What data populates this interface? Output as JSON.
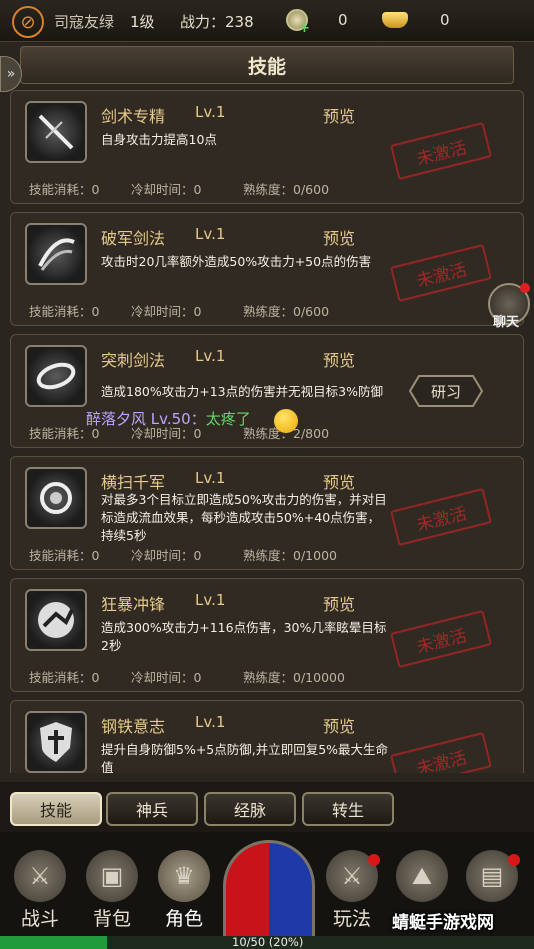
{
  "topbar": {
    "player_name": "司寇友绿",
    "player_level": "1级",
    "power": "战力：238",
    "coins": "0",
    "ingots": "0"
  },
  "panel": {
    "title": "技能"
  },
  "skills": [
    {
      "name": "剑术专精",
      "level": "Lv.1",
      "preview": "预览",
      "desc": "自身攻击力提高10点",
      "status": "未激活",
      "cost": "技能消耗：0",
      "cooldown": "冷却时间：0",
      "mastery": "熟练度：0/600"
    },
    {
      "name": "破军剑法",
      "level": "Lv.1",
      "preview": "预览",
      "desc": "攻击时20几率额外造成50%攻击力+50点的伤害",
      "status": "未激活",
      "cost": "技能消耗：0",
      "cooldown": "冷却时间：0",
      "mastery": "熟练度：0/600"
    },
    {
      "name": "突刺剑法",
      "level": "Lv.1",
      "preview": "预览",
      "desc": "造成180%攻击力+13点的伤害并无视目标3%防御",
      "action": "研习",
      "cost": "技能消耗：0",
      "cooldown": "冷却时间：0",
      "mastery": "熟练度：2/800"
    },
    {
      "name": "横扫千军",
      "level": "Lv.1",
      "preview": "预览",
      "desc": "对最多3个目标立即造成50%攻击力的伤害，并对目标造成流血效果，每秒造成攻击50%+40点伤害，持续5秒",
      "status": "未激活",
      "cost": "技能消耗：0",
      "cooldown": "冷却时间：0",
      "mastery": "熟练度：0/1000"
    },
    {
      "name": "狂暴冲锋",
      "level": "Lv.1",
      "preview": "预览",
      "desc": "造成300%攻击力+116点伤害，30%几率眩晕目标2秒",
      "status": "未激活",
      "cost": "技能消耗：0",
      "cooldown": "冷却时间：0",
      "mastery": "熟练度：0/10000"
    },
    {
      "name": "钢铁意志",
      "level": "Lv.1",
      "preview": "预览",
      "desc": "提升自身防御5%+5点防御,并立即回复5%最大生命值",
      "status": "未激活"
    }
  ],
  "chat": {
    "sender": "醉落夕风 Lv.50：",
    "message": "太疼了",
    "button_label": "聊天"
  },
  "subtabs": [
    "技能",
    "神兵",
    "经脉",
    "转生"
  ],
  "nav": [
    "战斗",
    "背包",
    "角色",
    "玩法"
  ],
  "xp": {
    "text": "10/50 (20%)",
    "fraction": 0.2
  },
  "watermark": "蜻蜓手游戏网"
}
